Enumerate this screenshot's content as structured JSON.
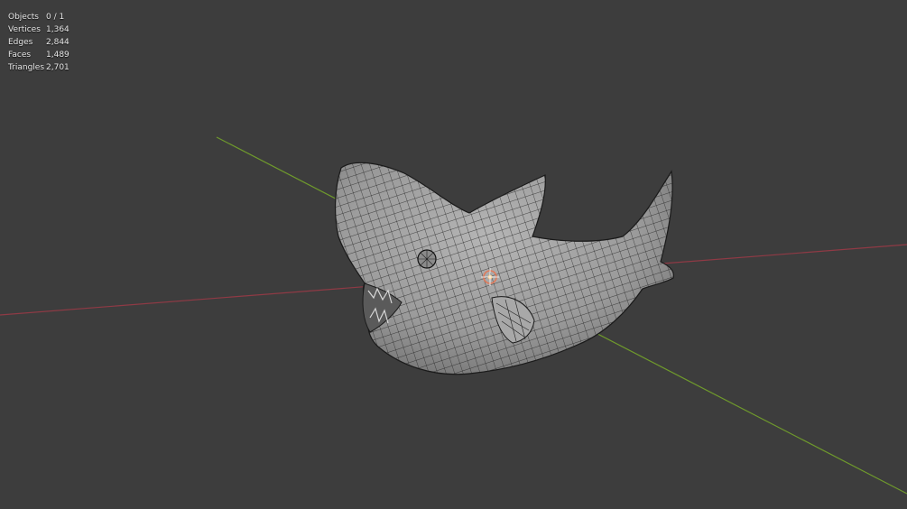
{
  "viewport": {
    "background_color": "#3d3d3d",
    "x_axis_color": "#8f3a45",
    "y_axis_color": "#6f9a2c",
    "mesh_fill_color": "#9a9a9a",
    "wire_color": "#1e1e1e",
    "object_name": "shark mesh",
    "origin_icon": "object-origin-icon"
  },
  "stats": [
    {
      "label": "Objects",
      "value": "0 / 1"
    },
    {
      "label": "Vertices",
      "value": "1,364"
    },
    {
      "label": "Edges",
      "value": "2,844"
    },
    {
      "label": "Faces",
      "value": "1,489"
    },
    {
      "label": "Triangles",
      "value": "2,701"
    }
  ]
}
